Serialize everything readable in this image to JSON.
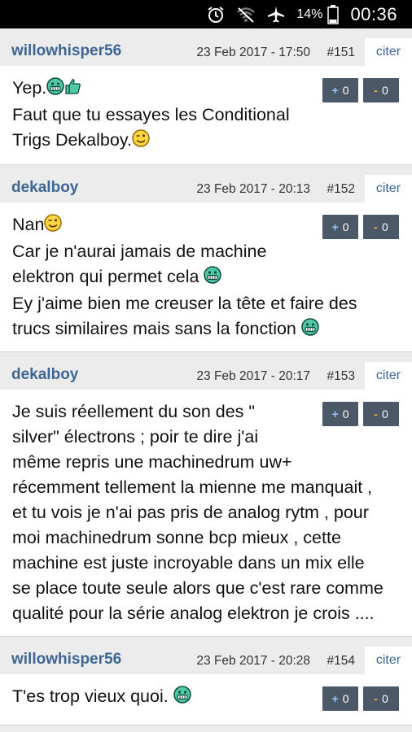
{
  "status_bar": {
    "battery_percent": "14%",
    "time": "00:36",
    "icons": [
      "alarm-icon",
      "wifi-icon",
      "airplane-icon",
      "battery-icon"
    ]
  },
  "colors": {
    "author": "#3d6694",
    "vote_button": "#4a5868",
    "plus_sign": "#9ec3ff",
    "minus_sign": "#ffb020"
  },
  "posts": [
    {
      "author": "willowhisper56",
      "date": "23 Feb 2017 - 17:50",
      "number": "#151",
      "quote_label": "citer",
      "upvote_sign": "+",
      "upvote_count": "0",
      "downvote_sign": "-",
      "downvote_count": "0",
      "lines": [
        "Yep.",
        "Faut que tu essayes les Conditional",
        "Trigs Dekalboy."
      ],
      "emojis": [
        "grin-smiley-icon",
        "thumbs-up-smiley-icon",
        "wink-smiley-icon"
      ]
    },
    {
      "author": "dekalboy",
      "date": "23 Feb 2017 - 20:13",
      "number": "#152",
      "quote_label": "citer",
      "upvote_sign": "+",
      "upvote_count": "0",
      "downvote_sign": "-",
      "downvote_count": "0",
      "lines": [
        "Nan",
        "Car je n'aurai jamais de machine",
        "elektron qui permet cela ",
        "Ey j'aime bien me creuser la tête et faire des",
        "trucs similaires mais sans la fonction "
      ],
      "emojis": [
        "wink-smiley-icon",
        "grin-smiley-icon",
        "grin-smiley-icon"
      ]
    },
    {
      "author": "dekalboy",
      "date": "23 Feb 2017 - 20:17",
      "number": "#153",
      "quote_label": "citer",
      "upvote_sign": "+",
      "upvote_count": "0",
      "downvote_sign": "-",
      "downvote_count": "0",
      "lines": [
        "Je suis réellement du son des \"",
        "silver\" électrons ; poir te dire j'ai",
        "même repris une machinedrum uw+",
        "récemment tellement la mienne me manquait ,",
        "et tu vois je n'ai pas pris de analog rytm , pour",
        "moi machinedrum sonne bcp mieux , cette",
        "machine est juste incroyable dans un mix elle",
        "se place toute seule alors que c'est rare comme",
        "qualité pour la série analog elektron je crois ...."
      ],
      "emojis": []
    },
    {
      "author": "willowhisper56",
      "date": "23 Feb 2017 - 20:28",
      "number": "#154",
      "quote_label": "citer",
      "upvote_sign": "+",
      "upvote_count": "0",
      "downvote_sign": "-",
      "downvote_count": "0",
      "lines": [
        "T'es trop vieux quoi. "
      ],
      "emojis": [
        "grin-smiley-icon"
      ]
    }
  ]
}
